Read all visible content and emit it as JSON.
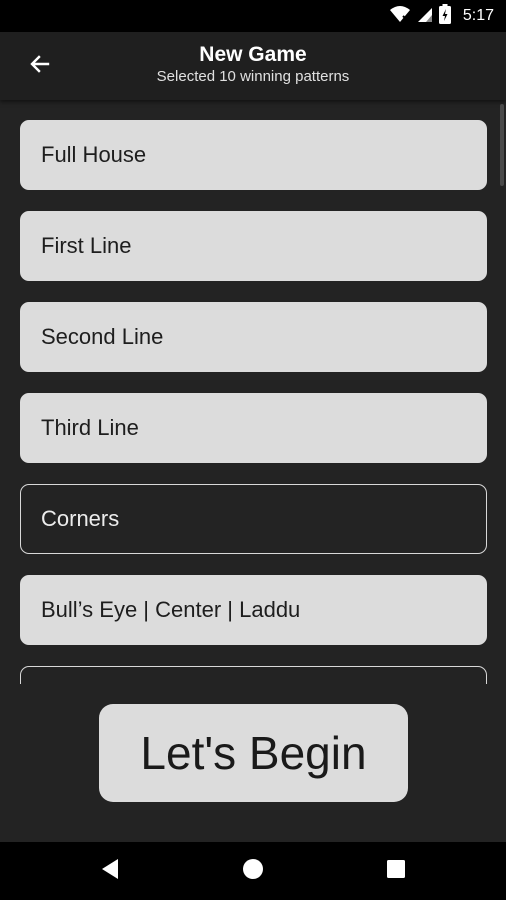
{
  "status_bar": {
    "time": "5:17"
  },
  "header": {
    "title": "New Game",
    "subtitle": "Selected 10 winning patterns"
  },
  "patterns": [
    {
      "label": "Full House",
      "selected": true
    },
    {
      "label": "First Line",
      "selected": true
    },
    {
      "label": "Second Line",
      "selected": true
    },
    {
      "label": "Third Line",
      "selected": true
    },
    {
      "label": "Corners",
      "selected": false
    },
    {
      "label": "Bull’s Eye | Center | Laddu",
      "selected": true
    },
    {
      "label": "",
      "selected": false
    }
  ],
  "actions": {
    "begin_label": "Let's Begin"
  },
  "icons": {
    "back": "arrow-back-icon",
    "wifi": "wifi-icon",
    "signal": "signal-icon",
    "battery": "battery-icon",
    "nav_back": "nav-back-icon",
    "nav_home": "nav-home-icon",
    "nav_recents": "nav-recents-icon"
  }
}
